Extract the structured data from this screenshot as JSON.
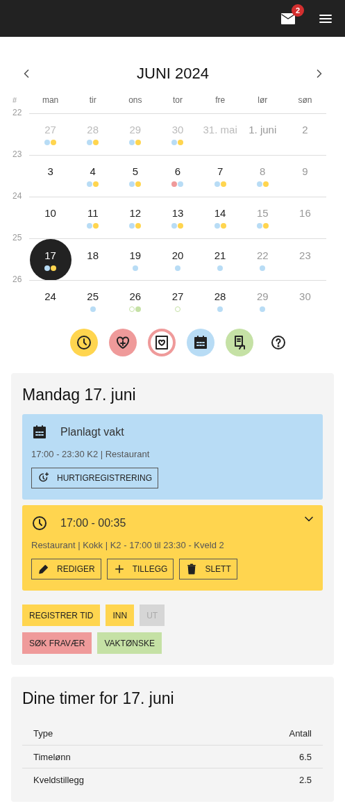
{
  "top_bar": {
    "mail_badge": "2"
  },
  "calendar": {
    "title": "JUNI 2024",
    "week_header": "#",
    "weekdays": [
      "man",
      "tir",
      "ons",
      "tor",
      "fre",
      "lør",
      "søn"
    ],
    "weeks": [
      {
        "number": "22",
        "days": [
          {
            "label": "27",
            "kind": "outside",
            "selected": false,
            "dots": [
              {
                "color": "#b8dcf5",
                "filled": true
              },
              {
                "color": "#ffd54f",
                "filled": true
              }
            ]
          },
          {
            "label": "28",
            "kind": "outside",
            "selected": false,
            "dots": [
              {
                "color": "#b8dcf5",
                "filled": true
              },
              {
                "color": "#ffd54f",
                "filled": true
              }
            ]
          },
          {
            "label": "29",
            "kind": "outside",
            "selected": false,
            "dots": [
              {
                "color": "#b8dcf5",
                "filled": true
              },
              {
                "color": "#ffd54f",
                "filled": true
              }
            ]
          },
          {
            "label": "30",
            "kind": "outside",
            "selected": false,
            "dots": [
              {
                "color": "#b8dcf5",
                "filled": true
              },
              {
                "color": "#ffd54f",
                "filled": true
              }
            ]
          },
          {
            "label": "31. mai",
            "kind": "outside",
            "selected": false
          },
          {
            "label": "1. juni",
            "kind": "weekend",
            "selected": false
          },
          {
            "label": "2",
            "kind": "weekend",
            "selected": false
          }
        ]
      },
      {
        "number": "23",
        "days": [
          {
            "label": "3",
            "kind": "normal",
            "selected": false
          },
          {
            "label": "4",
            "kind": "normal",
            "selected": false,
            "dots": [
              {
                "color": "#b8dcf5",
                "filled": true
              },
              {
                "color": "#ffd54f",
                "filled": true
              }
            ]
          },
          {
            "label": "5",
            "kind": "normal",
            "selected": false,
            "dots": [
              {
                "color": "#b8dcf5",
                "filled": true
              },
              {
                "color": "#ffd54f",
                "filled": true
              }
            ]
          },
          {
            "label": "6",
            "kind": "normal",
            "selected": false,
            "dots": [
              {
                "color": "#ef9a9a",
                "filled": true
              },
              {
                "color": "#b8dcf5",
                "filled": true
              }
            ]
          },
          {
            "label": "7",
            "kind": "normal",
            "selected": false,
            "dots": [
              {
                "color": "#b8dcf5",
                "filled": true
              },
              {
                "color": "#ffd54f",
                "filled": true
              }
            ]
          },
          {
            "label": "8",
            "kind": "weekend",
            "selected": false,
            "dots": [
              {
                "color": "#b8dcf5",
                "filled": true
              },
              {
                "color": "#ffd54f",
                "filled": true
              }
            ]
          },
          {
            "label": "9",
            "kind": "weekend",
            "selected": false
          }
        ]
      },
      {
        "number": "24",
        "days": [
          {
            "label": "10",
            "kind": "normal",
            "selected": false
          },
          {
            "label": "11",
            "kind": "normal",
            "selected": false,
            "dots": [
              {
                "color": "#b8dcf5",
                "filled": true
              },
              {
                "color": "#ffd54f",
                "filled": true
              }
            ]
          },
          {
            "label": "12",
            "kind": "normal",
            "selected": false,
            "dots": [
              {
                "color": "#b8dcf5",
                "filled": true
              },
              {
                "color": "#ffd54f",
                "filled": true
              }
            ]
          },
          {
            "label": "13",
            "kind": "normal",
            "selected": false,
            "dots": [
              {
                "color": "#b8dcf5",
                "filled": true
              },
              {
                "color": "#ffd54f",
                "filled": true
              }
            ]
          },
          {
            "label": "14",
            "kind": "normal",
            "selected": false,
            "dots": [
              {
                "color": "#b8dcf5",
                "filled": true
              },
              {
                "color": "#ffd54f",
                "filled": true
              }
            ]
          },
          {
            "label": "15",
            "kind": "weekend",
            "selected": false,
            "dots": [
              {
                "color": "#b8dcf5",
                "filled": true
              },
              {
                "color": "#ffd54f",
                "filled": true
              }
            ]
          },
          {
            "label": "16",
            "kind": "weekend",
            "selected": false
          }
        ]
      },
      {
        "number": "25",
        "days": [
          {
            "label": "17",
            "kind": "normal",
            "selected": true,
            "dots": [
              {
                "color": "#b8dcf5",
                "filled": true
              },
              {
                "color": "#ffd54f",
                "filled": true
              }
            ]
          },
          {
            "label": "18",
            "kind": "normal",
            "selected": false
          },
          {
            "label": "19",
            "kind": "normal",
            "selected": false,
            "dots": [
              {
                "color": "#b8dcf5",
                "filled": true
              }
            ]
          },
          {
            "label": "20",
            "kind": "normal",
            "selected": false,
            "dots": [
              {
                "color": "#b8dcf5",
                "filled": true
              }
            ]
          },
          {
            "label": "21",
            "kind": "normal",
            "selected": false,
            "dots": [
              {
                "color": "#b8dcf5",
                "filled": true
              }
            ]
          },
          {
            "label": "22",
            "kind": "weekend",
            "selected": false,
            "dots": [
              {
                "color": "#b8dcf5",
                "filled": true
              }
            ]
          },
          {
            "label": "23",
            "kind": "weekend",
            "selected": false
          }
        ]
      },
      {
        "number": "26",
        "days": [
          {
            "label": "24",
            "kind": "normal",
            "selected": false
          },
          {
            "label": "25",
            "kind": "normal",
            "selected": false,
            "dots": [
              {
                "color": "#b8dcf5",
                "filled": true
              }
            ]
          },
          {
            "label": "26",
            "kind": "normal",
            "selected": false,
            "dots": [
              {
                "color": "#c5e1a5",
                "filled": false
              },
              {
                "color": "#c5e1a5",
                "filled": true
              }
            ]
          },
          {
            "label": "27",
            "kind": "normal",
            "selected": false,
            "dots": [
              {
                "color": "#c5e1a5",
                "filled": false
              }
            ]
          },
          {
            "label": "28",
            "kind": "normal",
            "selected": false,
            "dots": [
              {
                "color": "#b8dcf5",
                "filled": true
              }
            ]
          },
          {
            "label": "29",
            "kind": "weekend",
            "selected": false,
            "dots": [
              {
                "color": "#b8dcf5",
                "filled": true
              }
            ]
          },
          {
            "label": "30",
            "kind": "weekend",
            "selected": false
          }
        ]
      }
    ]
  },
  "legend": [
    {
      "kind": "clock",
      "color": "#ffd54f"
    },
    {
      "kind": "heart",
      "color": "#ef9a9a"
    },
    {
      "kind": "sick-note",
      "color": "#ef9a9a"
    },
    {
      "kind": "calendar",
      "color": "#b8dcf5"
    },
    {
      "kind": "request",
      "color": "#c5e1a5"
    },
    {
      "kind": "help",
      "color": "#ffffff"
    }
  ],
  "day_panel": {
    "title": "Mandag 17. juni",
    "planned": {
      "title": "Planlagt vakt",
      "details": "17:00 - 23:30 K2 | Restaurant",
      "button": "HURTIGREGISTRERING"
    },
    "registration": {
      "time": "17:00 - 00:35",
      "expanded": false,
      "details": "Restaurant | Kokk | K2 - 17:00 til 23:30 - Kveld 2",
      "buttons": [
        {
          "kind": "edit",
          "label": "REDIGER"
        },
        {
          "kind": "add",
          "label": "TILLEGG"
        },
        {
          "kind": "delete",
          "label": "SLETT"
        }
      ]
    },
    "actions": [
      {
        "label": "REGISTRER TID",
        "color": "#ffd54f",
        "disabled": false
      },
      {
        "label": "INN",
        "color": "#ffd54f",
        "disabled": false
      },
      {
        "label": "UT",
        "color": "#d6d6d6",
        "disabled": true
      },
      {
        "label": "SØK FRAVÆR",
        "color": "#ef9a9a",
        "disabled": false
      },
      {
        "label": "VAKTØNSKE",
        "color": "#c5e1a5",
        "disabled": false
      }
    ]
  },
  "hours": {
    "title": "Dine timer for 17. juni",
    "columns": [
      "Type",
      "Antall"
    ],
    "rows": [
      [
        "Timelønn",
        "6.5"
      ],
      [
        "Kveldstillegg",
        "2.5"
      ]
    ]
  }
}
